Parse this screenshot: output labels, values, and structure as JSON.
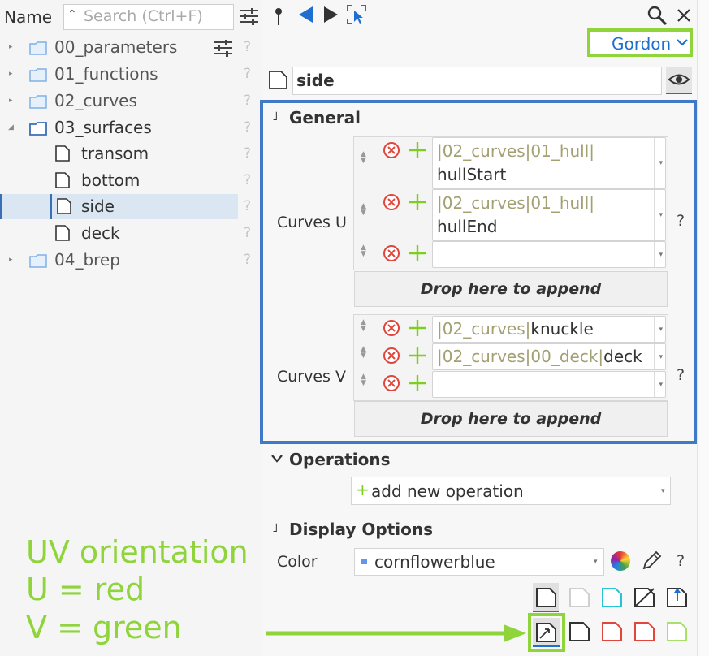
{
  "header": {
    "name_label": "Name",
    "search_placeholder": "Search (Ctrl+F)"
  },
  "tree": [
    {
      "label": "00_parameters",
      "type": "folder",
      "expanded": false
    },
    {
      "label": "01_functions",
      "type": "folder",
      "expanded": false
    },
    {
      "label": "02_curves",
      "type": "folder",
      "expanded": false
    },
    {
      "label": "03_surfaces",
      "type": "folder",
      "expanded": true
    },
    {
      "label": "transom",
      "type": "surface"
    },
    {
      "label": "bottom",
      "type": "surface"
    },
    {
      "label": "side",
      "type": "surface",
      "selected": true
    },
    {
      "label": "deck",
      "type": "surface"
    },
    {
      "label": "04_brep",
      "type": "folder",
      "expanded": false
    }
  ],
  "help_mark": "?",
  "type_select": {
    "value": "Gordon"
  },
  "object": {
    "name": "side"
  },
  "general": {
    "title": "General",
    "curves_u_label": "Curves U",
    "curves_u": [
      {
        "path": "|02_curves|01_hull|",
        "value": "hullStart"
      },
      {
        "path": "|02_curves|01_hull|",
        "value": "hullEnd"
      },
      {
        "path": "",
        "value": ""
      }
    ],
    "curves_v_label": "Curves V",
    "curves_v": [
      {
        "path": "|02_curves|",
        "value": "knuckle"
      },
      {
        "path": "|02_curves|00_deck|",
        "value": "deck"
      },
      {
        "path": "",
        "value": ""
      }
    ],
    "drop_label": "Drop here to append"
  },
  "operations": {
    "title": "Operations",
    "add_label": "add new operation",
    "add_symbol": "+"
  },
  "display": {
    "title": "Display Options",
    "color_label": "Color",
    "color_value": "cornflowerblue",
    "color_hex": "#6495ed"
  },
  "annotation": {
    "line1": "UV orientation",
    "line2": "U = red",
    "line3": "V = green"
  },
  "colors": {
    "accent_blue": "#1f6fd1",
    "highlight_green": "#8ed43a",
    "frame_blue": "#3f7ac9",
    "remove_red": "#e0463c",
    "add_green": "#7ccf1e"
  }
}
